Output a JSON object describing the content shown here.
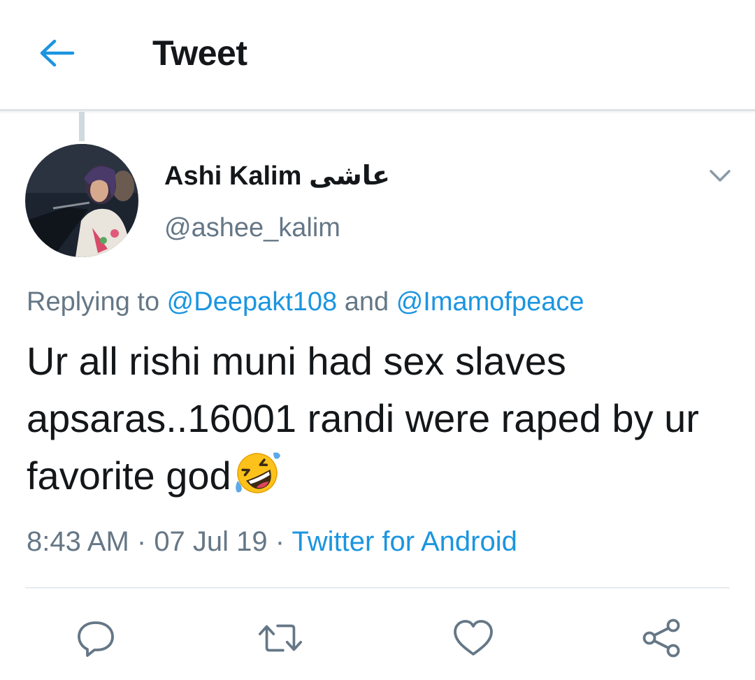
{
  "header": {
    "back_icon": "arrow-left-icon",
    "title": "Tweet"
  },
  "tweet": {
    "author": {
      "display_name": "Ashi Kalim عاشی",
      "handle": "@ashee_kalim",
      "avatar": "profile-photo"
    },
    "replying": {
      "prefix": "Replying to ",
      "users": [
        "@Deepakt108",
        "@Imamofpeace"
      ],
      "joiner": " and "
    },
    "text": "Ur all rishi muni had sex slaves apsaras..16001 randi were raped by ur favorite god",
    "emoji": "rolling-on-floor-laughing-emoji",
    "time": "8:43 AM",
    "date": "07 Jul 19",
    "separator": " · ",
    "source": "Twitter for Android"
  },
  "actions": [
    {
      "name": "reply",
      "icon": "reply-icon"
    },
    {
      "name": "retweet",
      "icon": "retweet-icon"
    },
    {
      "name": "like",
      "icon": "heart-icon"
    },
    {
      "name": "share",
      "icon": "share-icon"
    }
  ],
  "colors": {
    "accent": "#1b95e0",
    "secondary_text": "#657786",
    "primary_text": "#14171a",
    "divider": "#e6ecf0"
  }
}
